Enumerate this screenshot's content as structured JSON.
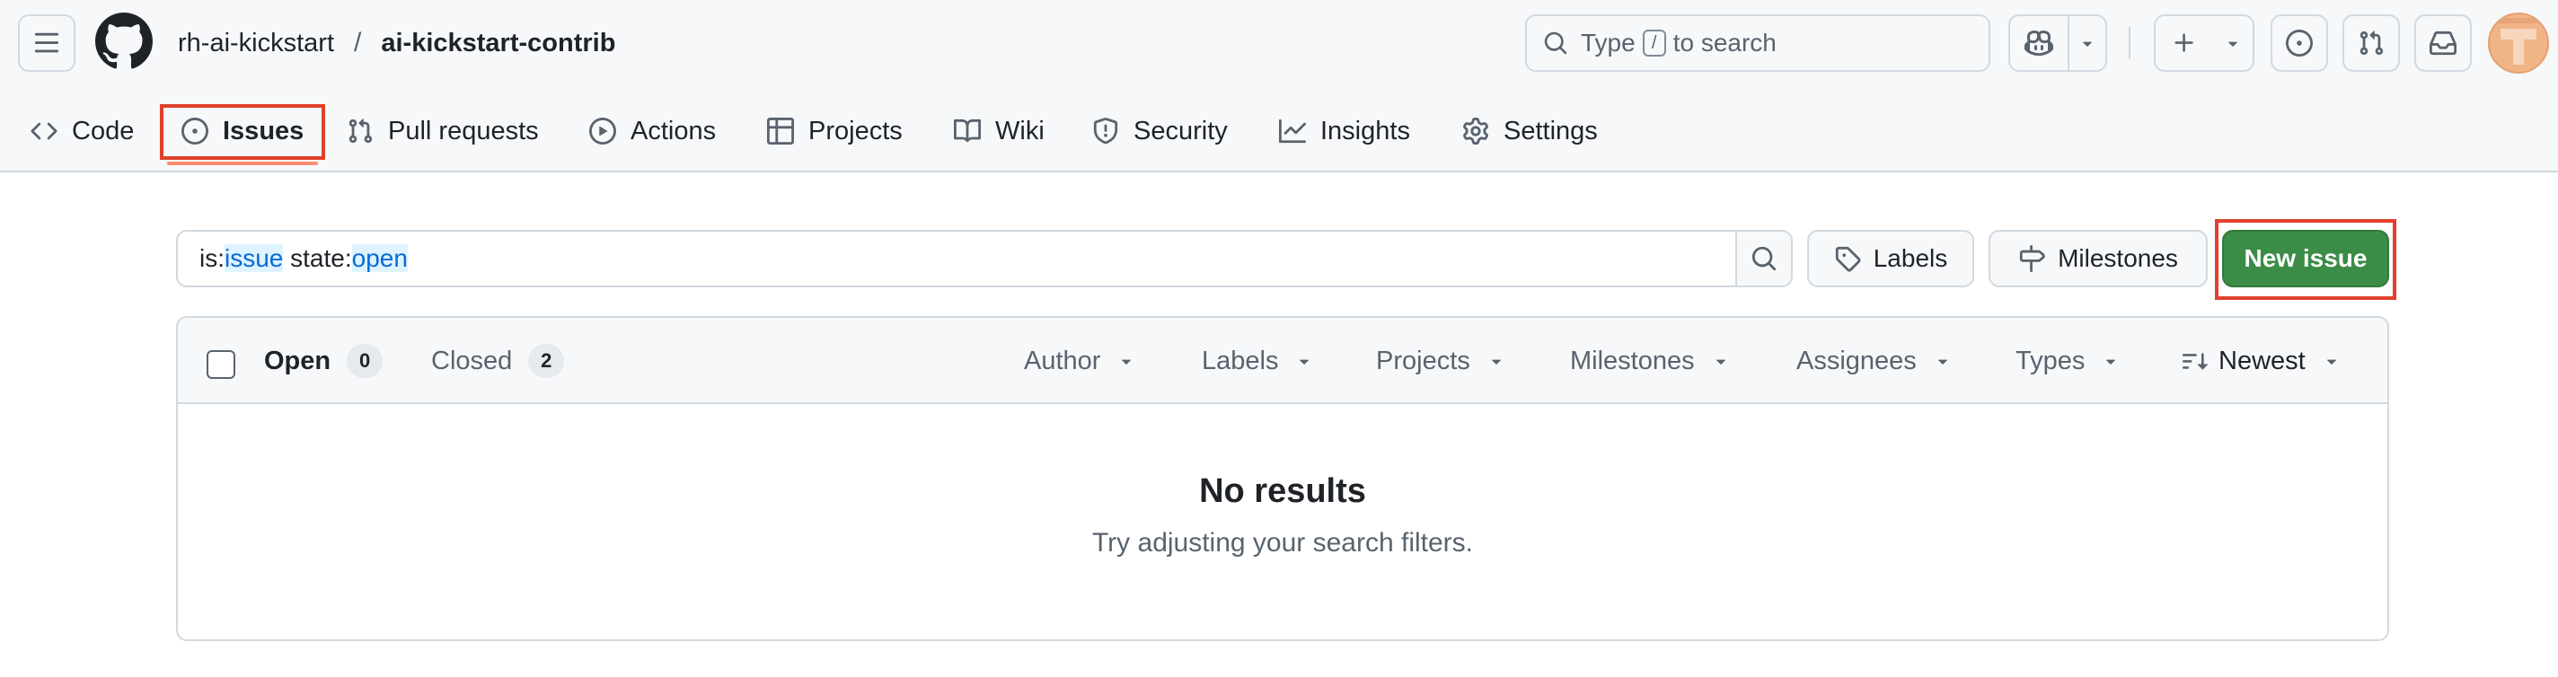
{
  "header": {
    "owner": "rh-ai-kickstart",
    "separator": "/",
    "repo": "ai-kickstart-contrib",
    "search": {
      "prefix": "Type",
      "key": "/",
      "suffix": "to search"
    },
    "avatar_letter": "T"
  },
  "tabs": [
    {
      "label": "Code",
      "icon": "code-icon"
    },
    {
      "label": "Issues",
      "icon": "issue-opened-icon",
      "selected": true
    },
    {
      "label": "Pull requests",
      "icon": "git-pull-request-icon"
    },
    {
      "label": "Actions",
      "icon": "play-icon"
    },
    {
      "label": "Projects",
      "icon": "table-icon"
    },
    {
      "label": "Wiki",
      "icon": "book-icon"
    },
    {
      "label": "Security",
      "icon": "shield-icon"
    },
    {
      "label": "Insights",
      "icon": "graph-icon"
    },
    {
      "label": "Settings",
      "icon": "gear-icon"
    }
  ],
  "filter": {
    "q1": "is:",
    "q2": "issue",
    "q3": " state:",
    "q4": "open"
  },
  "buttons": {
    "labels": "Labels",
    "milestones": "Milestones",
    "new_issue": "New issue"
  },
  "list": {
    "open_label": "Open",
    "open_count": "0",
    "closed_label": "Closed",
    "closed_count": "2",
    "filters": [
      "Author",
      "Labels",
      "Projects",
      "Milestones",
      "Assignees",
      "Types",
      "Newest"
    ],
    "empty_title": "No results",
    "empty_subtitle": "Try adjusting your search filters."
  },
  "colors": {
    "accent_green": "#3b8c46",
    "tab_underline": "#fd8c73",
    "highlight_box": "#e0402b",
    "link_blue": "#0969da"
  }
}
